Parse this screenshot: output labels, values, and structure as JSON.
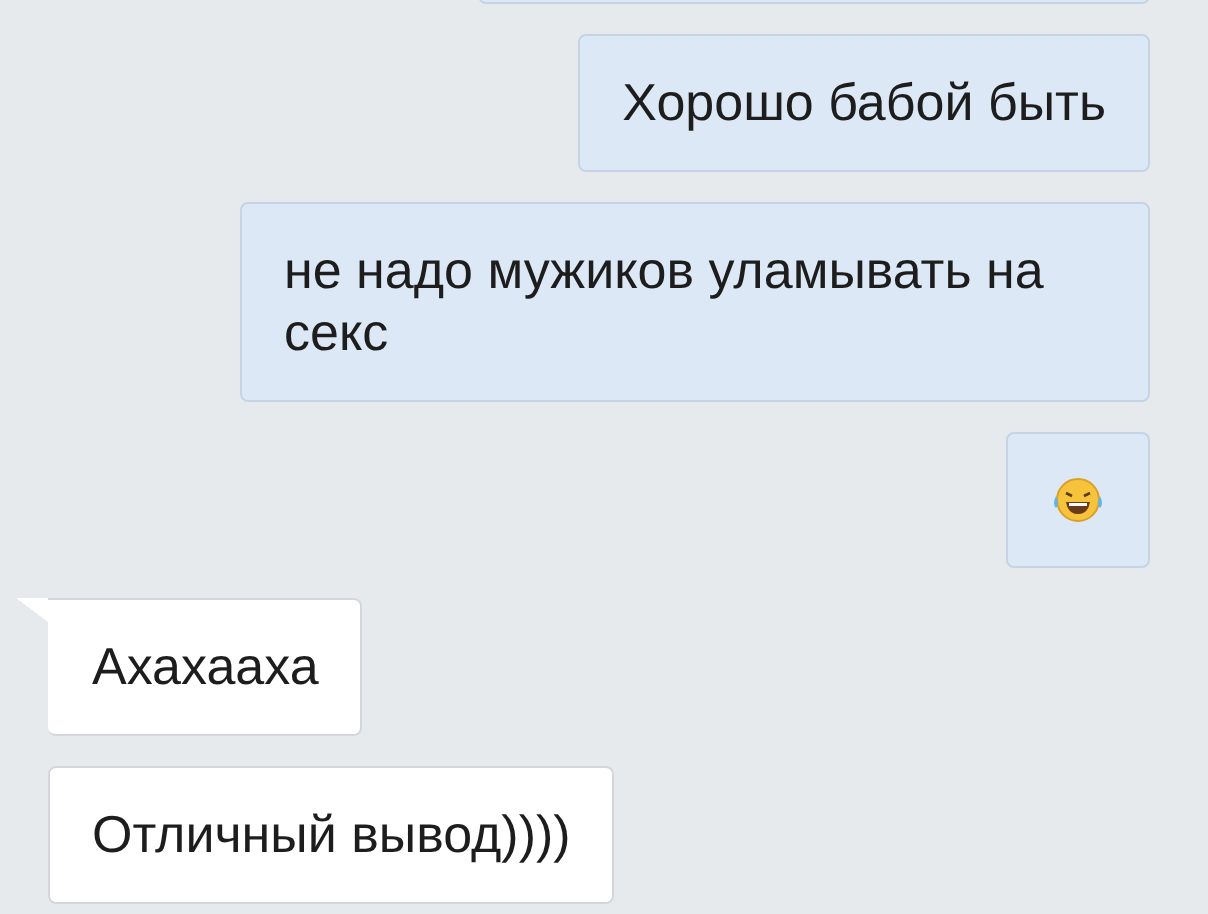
{
  "messages": [
    {
      "outgoing": true,
      "kind": "cut"
    },
    {
      "outgoing": true,
      "kind": "text",
      "text": "Хорошо бабой быть"
    },
    {
      "outgoing": true,
      "kind": "text",
      "text": "не надо мужиков уламывать на секс"
    },
    {
      "outgoing": true,
      "kind": "emoji"
    },
    {
      "outgoing": false,
      "kind": "text",
      "text": "Ахахааха",
      "tail": true
    },
    {
      "outgoing": false,
      "kind": "text",
      "text": "Отличный вывод))))",
      "tail": false
    }
  ]
}
